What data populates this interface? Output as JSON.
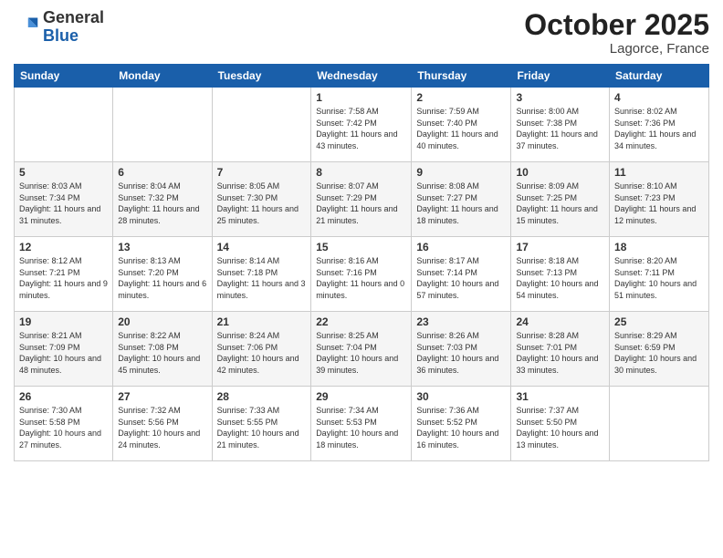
{
  "header": {
    "logo_general": "General",
    "logo_blue": "Blue",
    "month_title": "October 2025",
    "location": "Lagorce, France"
  },
  "days_of_week": [
    "Sunday",
    "Monday",
    "Tuesday",
    "Wednesday",
    "Thursday",
    "Friday",
    "Saturday"
  ],
  "weeks": [
    [
      {
        "day": "",
        "info": ""
      },
      {
        "day": "",
        "info": ""
      },
      {
        "day": "",
        "info": ""
      },
      {
        "day": "1",
        "info": "Sunrise: 7:58 AM\nSunset: 7:42 PM\nDaylight: 11 hours\nand 43 minutes."
      },
      {
        "day": "2",
        "info": "Sunrise: 7:59 AM\nSunset: 7:40 PM\nDaylight: 11 hours\nand 40 minutes."
      },
      {
        "day": "3",
        "info": "Sunrise: 8:00 AM\nSunset: 7:38 PM\nDaylight: 11 hours\nand 37 minutes."
      },
      {
        "day": "4",
        "info": "Sunrise: 8:02 AM\nSunset: 7:36 PM\nDaylight: 11 hours\nand 34 minutes."
      }
    ],
    [
      {
        "day": "5",
        "info": "Sunrise: 8:03 AM\nSunset: 7:34 PM\nDaylight: 11 hours\nand 31 minutes."
      },
      {
        "day": "6",
        "info": "Sunrise: 8:04 AM\nSunset: 7:32 PM\nDaylight: 11 hours\nand 28 minutes."
      },
      {
        "day": "7",
        "info": "Sunrise: 8:05 AM\nSunset: 7:30 PM\nDaylight: 11 hours\nand 25 minutes."
      },
      {
        "day": "8",
        "info": "Sunrise: 8:07 AM\nSunset: 7:29 PM\nDaylight: 11 hours\nand 21 minutes."
      },
      {
        "day": "9",
        "info": "Sunrise: 8:08 AM\nSunset: 7:27 PM\nDaylight: 11 hours\nand 18 minutes."
      },
      {
        "day": "10",
        "info": "Sunrise: 8:09 AM\nSunset: 7:25 PM\nDaylight: 11 hours\nand 15 minutes."
      },
      {
        "day": "11",
        "info": "Sunrise: 8:10 AM\nSunset: 7:23 PM\nDaylight: 11 hours\nand 12 minutes."
      }
    ],
    [
      {
        "day": "12",
        "info": "Sunrise: 8:12 AM\nSunset: 7:21 PM\nDaylight: 11 hours\nand 9 minutes."
      },
      {
        "day": "13",
        "info": "Sunrise: 8:13 AM\nSunset: 7:20 PM\nDaylight: 11 hours\nand 6 minutes."
      },
      {
        "day": "14",
        "info": "Sunrise: 8:14 AM\nSunset: 7:18 PM\nDaylight: 11 hours\nand 3 minutes."
      },
      {
        "day": "15",
        "info": "Sunrise: 8:16 AM\nSunset: 7:16 PM\nDaylight: 11 hours\nand 0 minutes."
      },
      {
        "day": "16",
        "info": "Sunrise: 8:17 AM\nSunset: 7:14 PM\nDaylight: 10 hours\nand 57 minutes."
      },
      {
        "day": "17",
        "info": "Sunrise: 8:18 AM\nSunset: 7:13 PM\nDaylight: 10 hours\nand 54 minutes."
      },
      {
        "day": "18",
        "info": "Sunrise: 8:20 AM\nSunset: 7:11 PM\nDaylight: 10 hours\nand 51 minutes."
      }
    ],
    [
      {
        "day": "19",
        "info": "Sunrise: 8:21 AM\nSunset: 7:09 PM\nDaylight: 10 hours\nand 48 minutes."
      },
      {
        "day": "20",
        "info": "Sunrise: 8:22 AM\nSunset: 7:08 PM\nDaylight: 10 hours\nand 45 minutes."
      },
      {
        "day": "21",
        "info": "Sunrise: 8:24 AM\nSunset: 7:06 PM\nDaylight: 10 hours\nand 42 minutes."
      },
      {
        "day": "22",
        "info": "Sunrise: 8:25 AM\nSunset: 7:04 PM\nDaylight: 10 hours\nand 39 minutes."
      },
      {
        "day": "23",
        "info": "Sunrise: 8:26 AM\nSunset: 7:03 PM\nDaylight: 10 hours\nand 36 minutes."
      },
      {
        "day": "24",
        "info": "Sunrise: 8:28 AM\nSunset: 7:01 PM\nDaylight: 10 hours\nand 33 minutes."
      },
      {
        "day": "25",
        "info": "Sunrise: 8:29 AM\nSunset: 6:59 PM\nDaylight: 10 hours\nand 30 minutes."
      }
    ],
    [
      {
        "day": "26",
        "info": "Sunrise: 7:30 AM\nSunset: 5:58 PM\nDaylight: 10 hours\nand 27 minutes."
      },
      {
        "day": "27",
        "info": "Sunrise: 7:32 AM\nSunset: 5:56 PM\nDaylight: 10 hours\nand 24 minutes."
      },
      {
        "day": "28",
        "info": "Sunrise: 7:33 AM\nSunset: 5:55 PM\nDaylight: 10 hours\nand 21 minutes."
      },
      {
        "day": "29",
        "info": "Sunrise: 7:34 AM\nSunset: 5:53 PM\nDaylight: 10 hours\nand 18 minutes."
      },
      {
        "day": "30",
        "info": "Sunrise: 7:36 AM\nSunset: 5:52 PM\nDaylight: 10 hours\nand 16 minutes."
      },
      {
        "day": "31",
        "info": "Sunrise: 7:37 AM\nSunset: 5:50 PM\nDaylight: 10 hours\nand 13 minutes."
      },
      {
        "day": "",
        "info": ""
      }
    ]
  ]
}
